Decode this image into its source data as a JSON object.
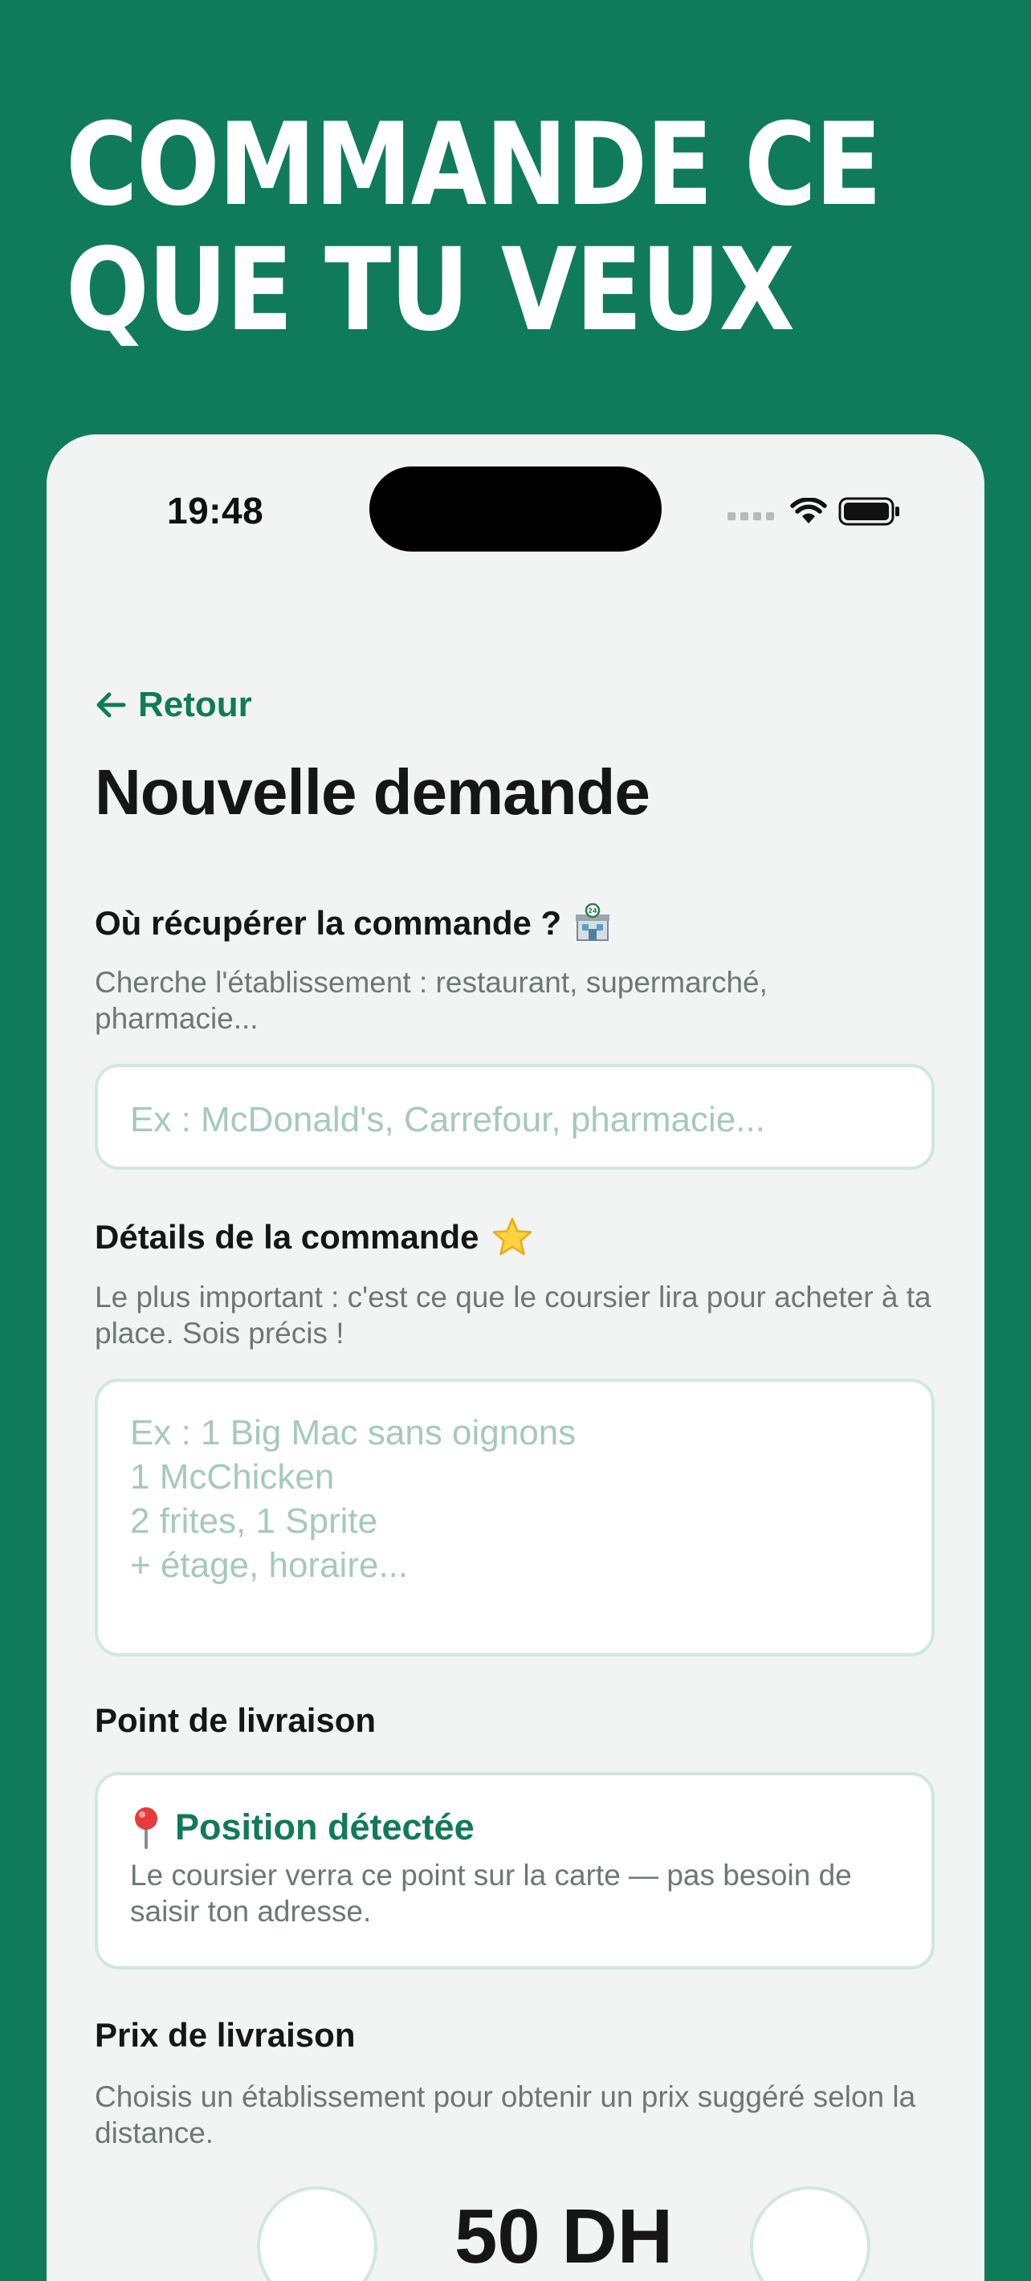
{
  "hero": {
    "line1": "COMMANDE CE",
    "line2": "QUE TU VEUX"
  },
  "status_bar": {
    "time": "19:48"
  },
  "nav": {
    "back_label": "Retour"
  },
  "page": {
    "title": "Nouvelle demande"
  },
  "pickup": {
    "label": "Où récupérer la commande ?",
    "icon": "store-24h-icon",
    "help": "Cherche l'établissement : restaurant, supermarché, pharmacie...",
    "placeholder": "Ex : McDonald's, Carrefour, pharmacie..."
  },
  "details": {
    "label": "Détails de la commande",
    "icon": "star-icon",
    "help": "Le plus important : c'est ce que le coursier lira pour acheter à ta place. Sois précis !",
    "placeholder_lines": [
      "Ex : 1 Big Mac sans oignons",
      "1 McChicken",
      "2 frites, 1 Sprite",
      "+ étage, horaire..."
    ]
  },
  "delivery_point": {
    "label": "Point de livraison",
    "status": "Position détectée",
    "icon": "pin-icon",
    "text": "Le coursier verra ce point sur la carte — pas besoin de saisir ton adresse."
  },
  "price": {
    "label": "Prix de livraison",
    "help": "Choisis un établissement pour obtenir un prix suggéré selon la distance.",
    "value": "50 DH"
  },
  "colors": {
    "brand": "#0f7b5a",
    "accent": "#117a57",
    "field_border": "#cfe8dd"
  }
}
